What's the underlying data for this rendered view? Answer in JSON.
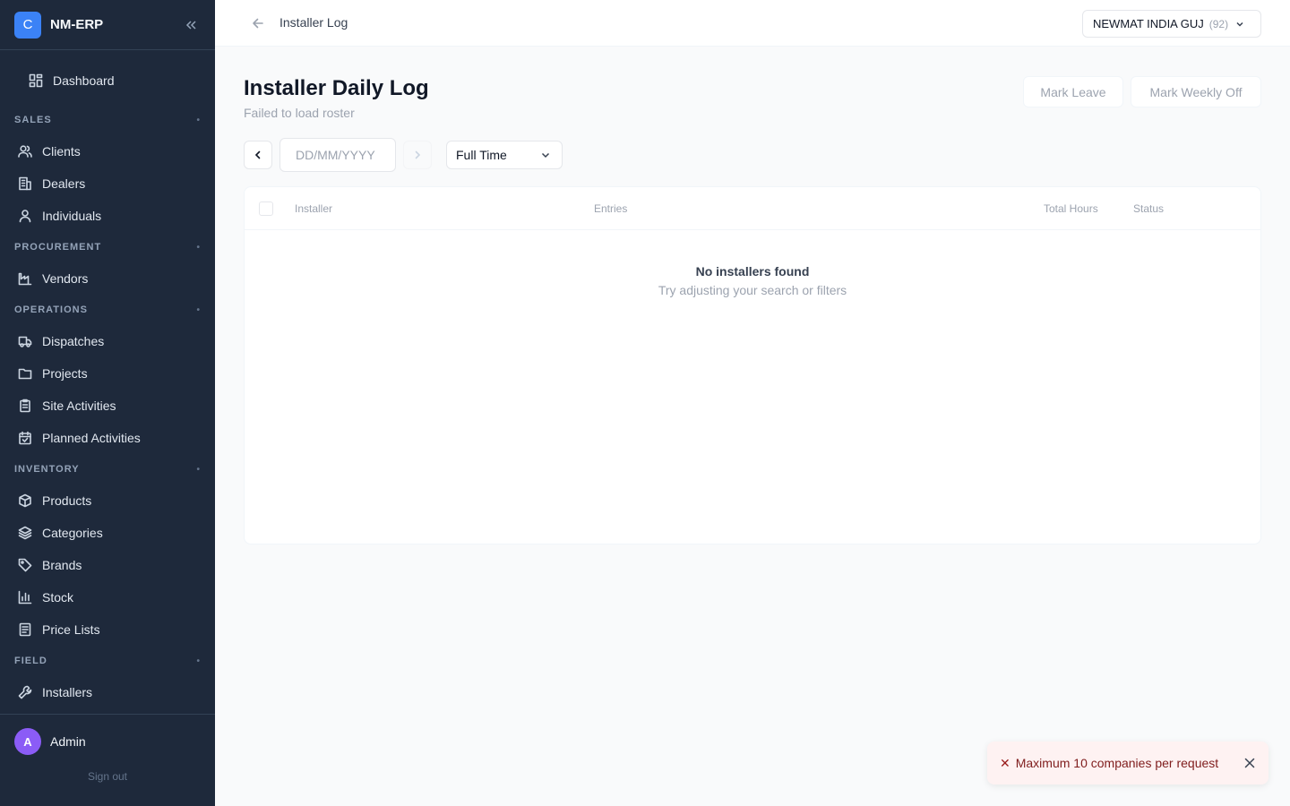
{
  "app": {
    "logo_letter": "C",
    "name": "NM-ERP"
  },
  "sidebar": {
    "dashboard": "Dashboard",
    "sections": [
      {
        "label": "SALES",
        "items": [
          "Clients",
          "Dealers",
          "Individuals"
        ]
      },
      {
        "label": "PROCUREMENT",
        "items": [
          "Vendors"
        ]
      },
      {
        "label": "OPERATIONS",
        "items": [
          "Dispatches",
          "Projects",
          "Site Activities",
          "Planned Activities"
        ]
      },
      {
        "label": "INVENTORY",
        "items": [
          "Products",
          "Categories",
          "Brands",
          "Stock",
          "Price Lists"
        ]
      },
      {
        "label": "FIELD",
        "items": [
          "Installers"
        ]
      }
    ],
    "section_dot": "•"
  },
  "user": {
    "initial": "A",
    "name": "Admin",
    "signout": "Sign out"
  },
  "topbar": {
    "breadcrumb": "Installer Log",
    "company": "NEWMAT INDIA GUJ",
    "company_count": "(92)"
  },
  "page": {
    "title": "Installer Daily Log",
    "subtitle": "Failed to load roster"
  },
  "actions": {
    "mark_leave": "Mark Leave",
    "mark_weekly_off": "Mark Weekly Off"
  },
  "filters": {
    "date_placeholder": "DD/MM/YYYY",
    "employment_type": "Full Time"
  },
  "table": {
    "columns": {
      "installer": "Installer",
      "entries": "Entries",
      "total_hours": "Total Hours",
      "status": "Status"
    },
    "empty_title": "No installers found",
    "empty_sub": "Try adjusting your search or filters"
  },
  "toast": {
    "icon": "✕",
    "message": "Maximum 10 companies per request"
  }
}
